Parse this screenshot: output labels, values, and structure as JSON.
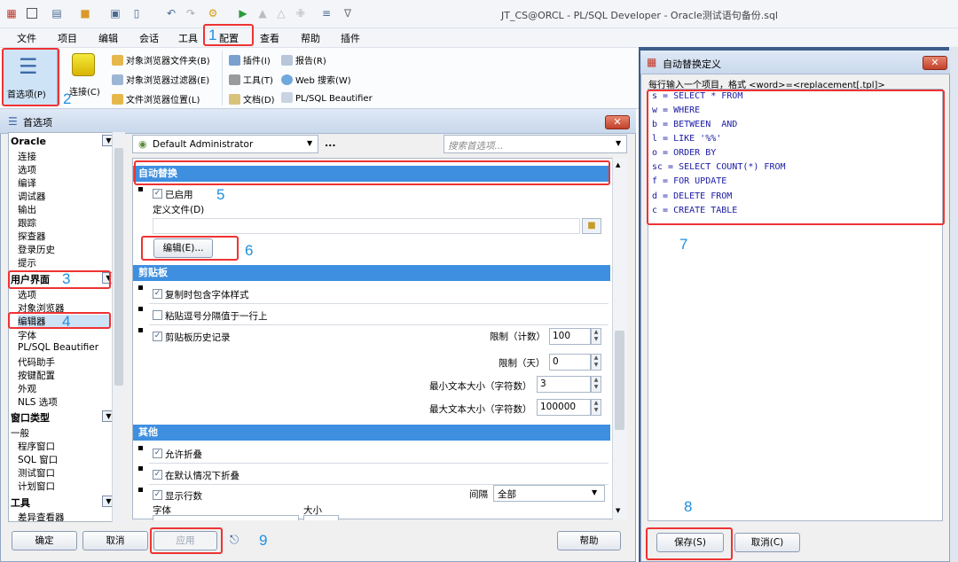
{
  "app": {
    "title": "JT_CS@ORCL - PL/SQL Developer - Oracle测试语句备份.sql"
  },
  "menu": [
    "文件",
    "项目",
    "编辑",
    "会话",
    "工具",
    "配置",
    "查看",
    "帮助",
    "插件"
  ],
  "ribbon": {
    "preferences": "首选项(P)",
    "connect": "连接(C)",
    "obj_browser_folder": "对象浏览器文件夹(B)",
    "obj_browser_filter": "对象浏览器过滤器(E)",
    "file_browser_loc": "文件浏览器位置(L)",
    "plugins": "插件(I)",
    "tools": "工具(T)",
    "docs": "文档(D)",
    "reports": "报告(R)",
    "web_search": "Web 搜索(W)",
    "beautifier": "PL/SQL Beautifier"
  },
  "prefs": {
    "title": "首选项",
    "user": "Default Administrator",
    "user_more": "...",
    "search_placeholder": "搜索首选项...",
    "sidebar": {
      "oracle": "Oracle",
      "oracle_items": [
        "连接",
        "选项",
        "编译",
        "调试器",
        "输出",
        "跟踪",
        "探查器",
        "登录历史",
        "提示"
      ],
      "ui": "用户界面",
      "ui_items": [
        "选项",
        "对象浏览器",
        "编辑器",
        "字体",
        "PL/SQL Beautifier",
        "代码助手",
        "按键配置",
        "外观",
        "NLS 选项"
      ],
      "window": "窗口类型",
      "window_items": [
        "一般",
        "程序窗口",
        "SQL 窗口",
        "测试窗口",
        "计划窗口"
      ],
      "tools": "工具",
      "tools_items": [
        "差异查看器"
      ]
    },
    "auto_replace": {
      "header": "自动替换",
      "enabled": "已启用",
      "def_file": "定义文件(D)",
      "edit_btn": "编辑(E)..."
    },
    "clipboard": {
      "header": "剪贴板",
      "copy_fonts": "复制时包含字体样式",
      "paste_comma": "粘贴逗号分隔值于一行上",
      "history": "剪贴板历史记录",
      "limit_count_label": "限制（计数）",
      "limit_count": "100",
      "limit_days_label": "限制（天）",
      "limit_days": "0",
      "min_size_label": "最小文本大小（字符数）",
      "min_size": "3",
      "max_size_label": "最大文本大小（字符数）",
      "max_size": "100000"
    },
    "other": {
      "header": "其他",
      "allow_fold": "允许折叠",
      "fold_default": "在默认情况下折叠",
      "show_lines": "显示行数",
      "interval_label": "间隔",
      "interval": "全部",
      "font_label": "字体",
      "size_label": "大小"
    },
    "buttons": {
      "ok": "确定",
      "cancel": "取消",
      "apply": "应用",
      "help": "帮助"
    }
  },
  "replace_dialog": {
    "title": "自动替换定义",
    "hint": "每行输入一个项目，格式 <word>=<replacement[.tpl]>",
    "lines": [
      "s = SELECT * FROM",
      "w = WHERE",
      "b = BETWEEN  AND",
      "l = LIKE '%%'",
      "o = ORDER BY",
      "sc = SELECT COUNT(*) FROM",
      "f = FOR UPDATE",
      "d = DELETE FROM",
      "c = CREATE TABLE"
    ],
    "save": "保存(S)",
    "cancel": "取消(C)"
  },
  "annotations": [
    "1",
    "2",
    "3",
    "4",
    "5",
    "6",
    "7",
    "8",
    "9"
  ]
}
